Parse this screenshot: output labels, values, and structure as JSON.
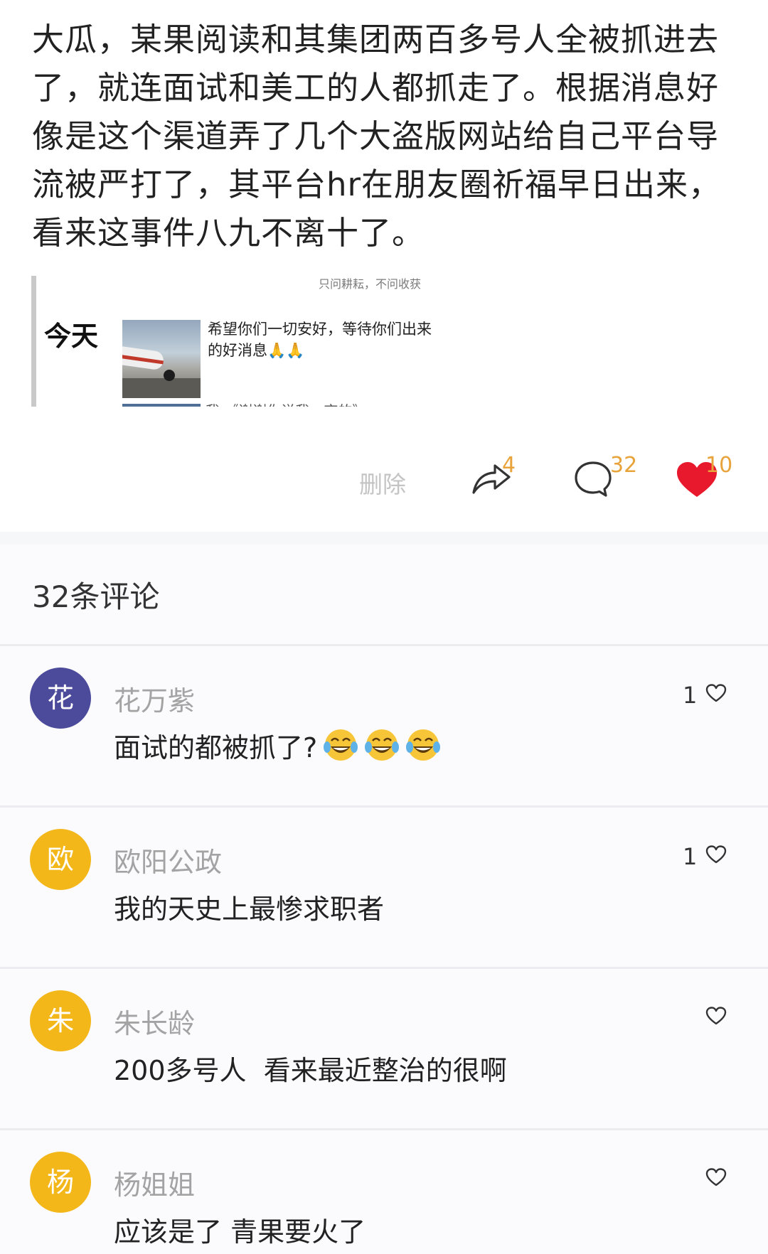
{
  "post": {
    "text": "大瓜，某果阅读和其集团两百多号人全被抓进去了，就连面试和美工的人都抓走了。根据消息好像是这个渠道弄了几个大盗版网站给自己平台导流被严打了，其平台hr在朋友圈祈福早日出来，看来这事件八九不离十了。",
    "quote": {
      "top_text": "只问耕耘，不问收获",
      "today_label": "今天",
      "message": "希望你们一切安好，等待你们出来的好消息🙏🙏",
      "bottom_text": "我 《谢谢你说我一夜的》"
    }
  },
  "actions": {
    "delete_label": "删除",
    "share_count": "4",
    "comment_count": "32",
    "like_count": "10",
    "colors": {
      "count": "#e8a33b",
      "like_heart": "#e8192c"
    }
  },
  "comments_section": {
    "title": "32条评论",
    "comments": [
      {
        "avatar_char": "花",
        "avatar_color": "#4b4a9b",
        "username": "花万紫",
        "text": "面试的都被抓了?",
        "emoji": [
          "tears-of-joy-emoji",
          "tears-of-joy-emoji",
          "tears-of-joy-emoji"
        ],
        "like_count": "1"
      },
      {
        "avatar_char": "欧",
        "avatar_color": "#f3b71a",
        "username": "欧阳公政",
        "text": "我的天史上最惨求职者",
        "like_count": "1"
      },
      {
        "avatar_char": "朱",
        "avatar_color": "#f3b71a",
        "username": "朱长龄",
        "text": "200多号人  看来最近整治的很啊",
        "like_count": ""
      },
      {
        "avatar_char": "杨",
        "avatar_color": "#f3b71a",
        "username": "杨姐姐",
        "text": "应该是了 青果要火了",
        "like_count": ""
      }
    ]
  }
}
